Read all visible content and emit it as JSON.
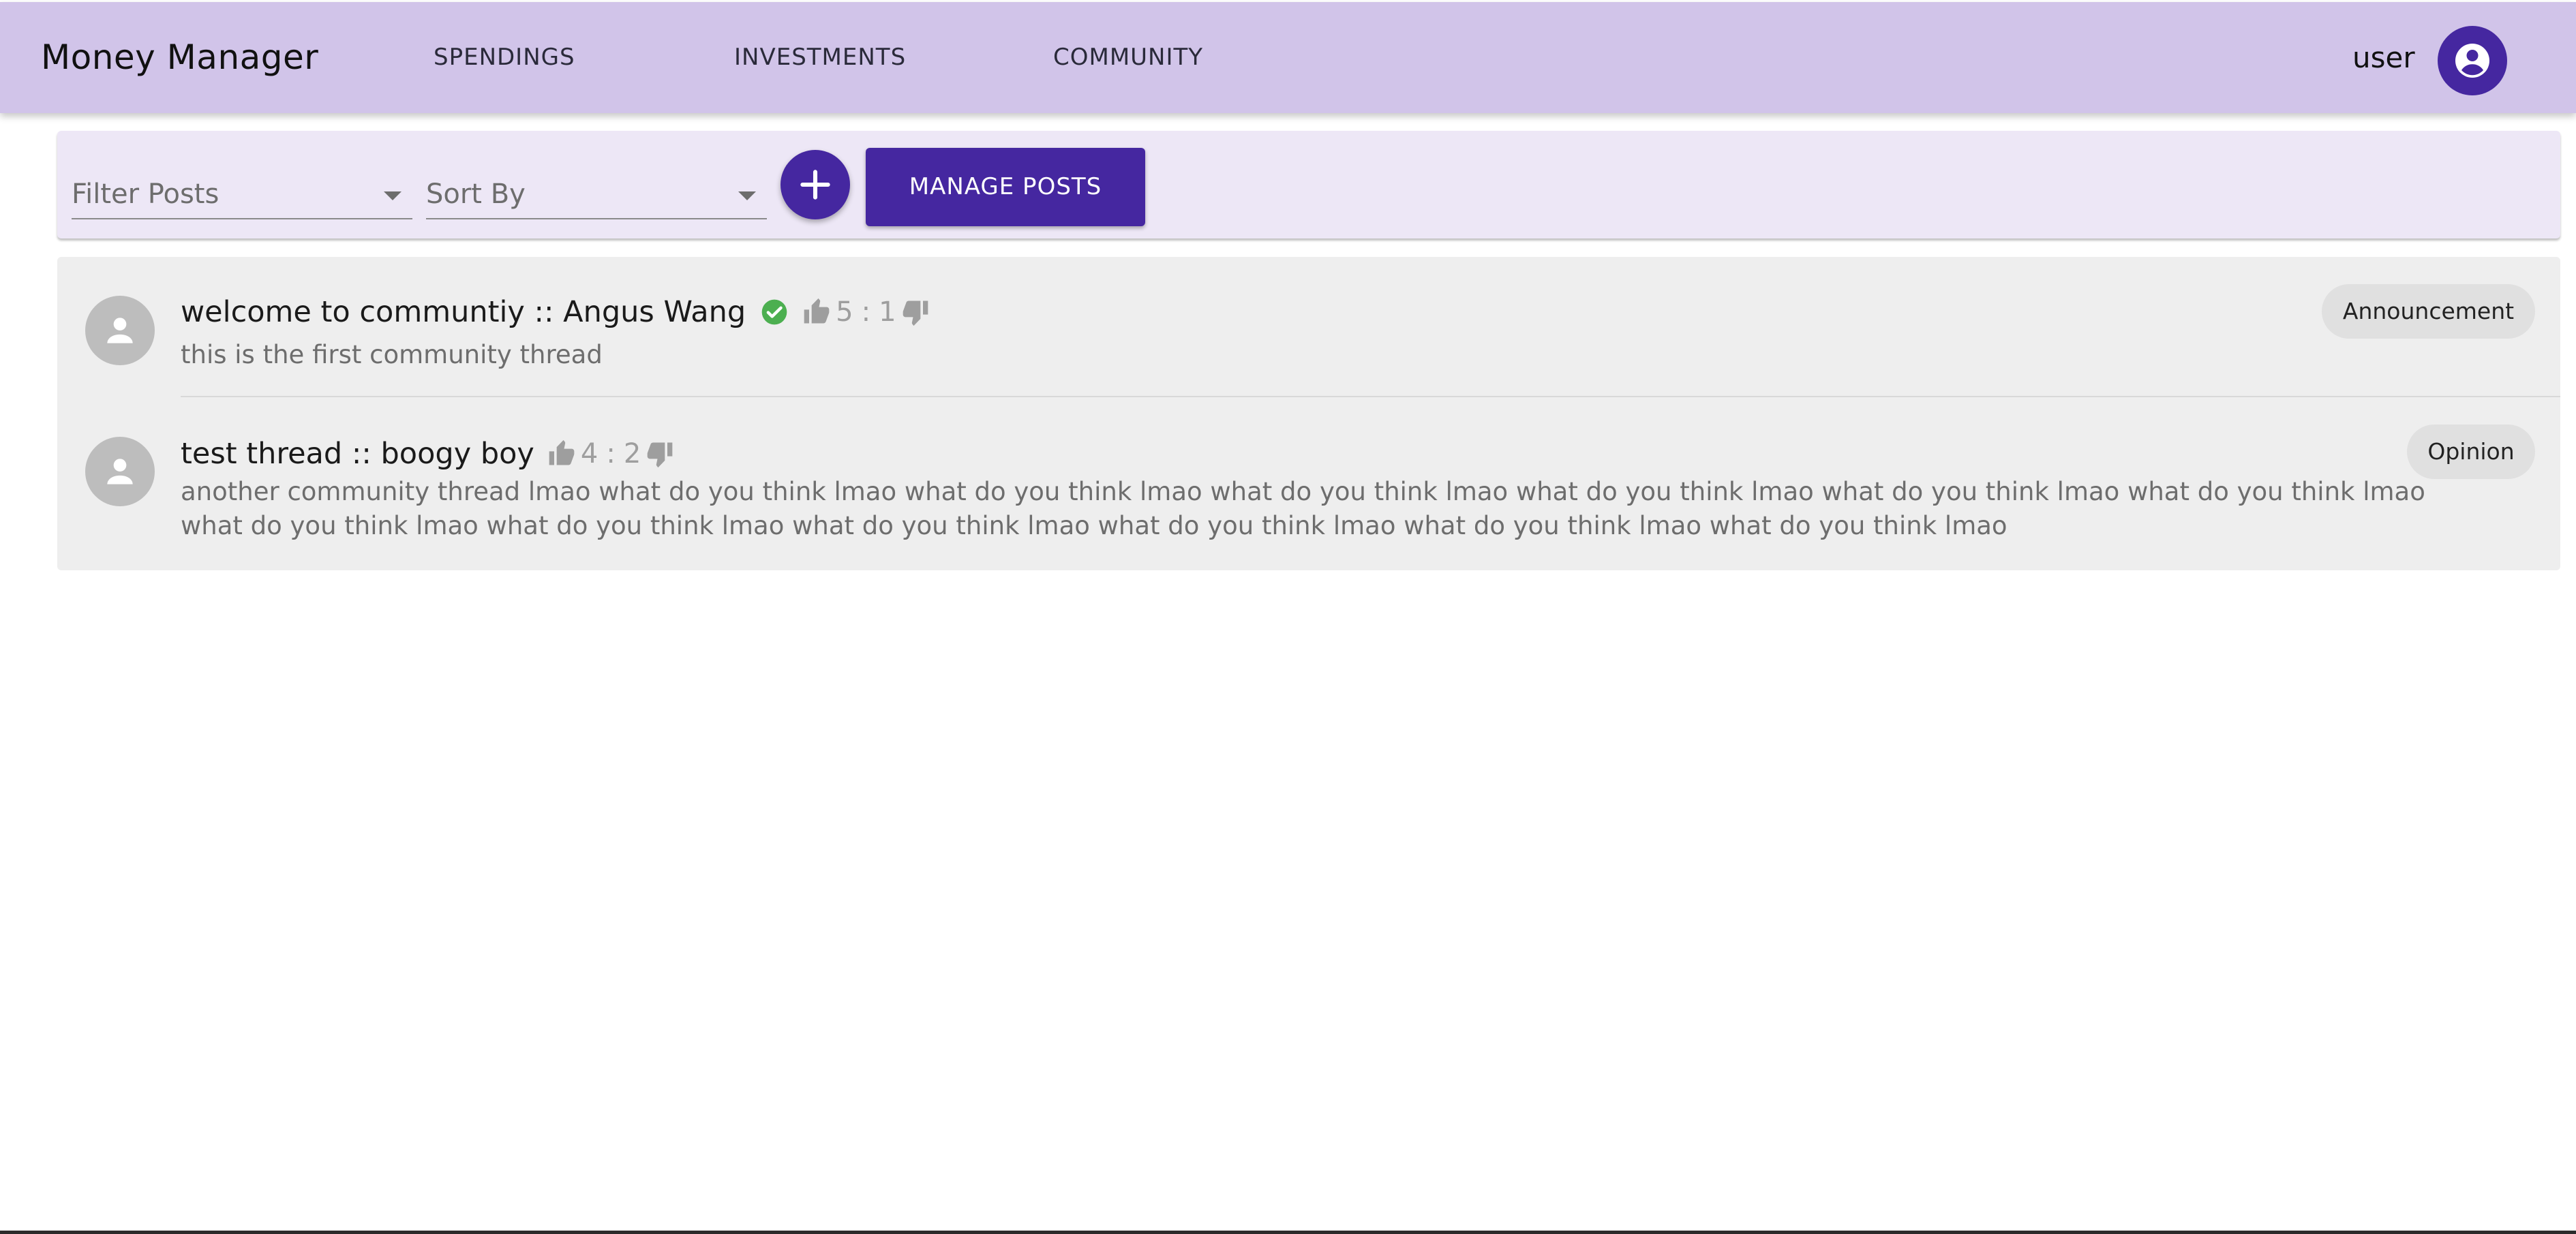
{
  "app": {
    "title": "Money Manager",
    "nav": [
      {
        "label": "SPENDINGS"
      },
      {
        "label": "INVESTMENTS"
      },
      {
        "label": "COMMUNITY"
      }
    ],
    "user": {
      "name": "user",
      "icon": "account-circle-icon"
    }
  },
  "toolbar": {
    "filter_label": "Filter Posts",
    "sort_label": "Sort By",
    "add_icon": "plus-icon",
    "manage_label": "MANAGE POSTS"
  },
  "posts": [
    {
      "title": "welcome to communtiy :: Angus Wang",
      "verified": true,
      "likes": "5",
      "separator": ":",
      "dislikes": "1",
      "body": "this is the first community thread",
      "tag": "Announcement"
    },
    {
      "title": "test thread :: boogy boy",
      "verified": false,
      "likes": "4",
      "separator": ":",
      "dislikes": "2",
      "body": "another community thread lmao what do you think lmao what do you think lmao what do you think lmao what do you think lmao what do you think lmao what do you think lmao what do you think lmao what do you think lmao what do you think lmao what do you think lmao what do you think lmao what do you think lmao",
      "tag": "Opinion"
    }
  ],
  "colors": {
    "appbar": "#d1c4e9",
    "toolbar": "#ede7f6",
    "primary": "#4527a0",
    "list_bg": "#eeeeee",
    "verified": "#4caf50",
    "muted": "#9e9e9e"
  }
}
